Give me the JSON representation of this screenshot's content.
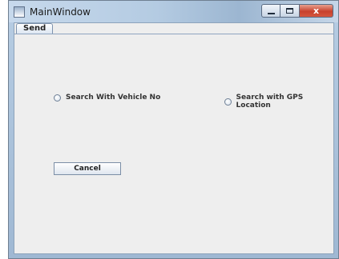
{
  "window": {
    "title": "MainWindow",
    "close_glyph": "x"
  },
  "tabs": [
    {
      "label": "Send",
      "selected": true
    }
  ],
  "options": {
    "vehicle_no_label": "Search With Vehicle No",
    "gps_label": "Search with GPS Location",
    "vehicle_no_selected": false,
    "gps_selected": false
  },
  "buttons": {
    "cancel_label": "Cancel"
  },
  "icons": {
    "app": "app-window-icon",
    "minimize": "minimize-icon",
    "maximize": "maximize-icon",
    "close": "close-icon"
  }
}
